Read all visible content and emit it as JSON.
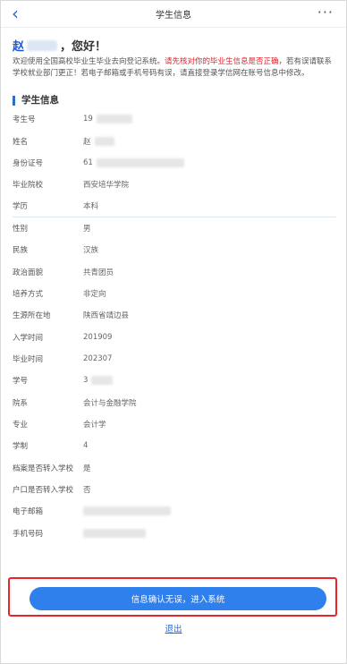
{
  "header": {
    "title": "学生信息",
    "back_icon": "chevron-left-icon",
    "more_icon": "more-dots-icon"
  },
  "greeting": {
    "surname": "赵",
    "suffix": "，您好！"
  },
  "intro": {
    "text_before": "欢迎使用全国高校毕业生毕业去向登记系统。",
    "text_red": "请先核对你的毕业生信息是否正确",
    "text_after": "，若有误请联系学校就业部门更正！若电子邮箱或手机号码有误，请直接登录学信网在账号信息中修改。"
  },
  "section": {
    "title": "学生信息"
  },
  "fields": [
    {
      "label": "考生号",
      "value": "19"
    },
    {
      "label": "姓名",
      "value": "赵"
    },
    {
      "label": "身份证号",
      "value": "61"
    },
    {
      "label": "毕业院校",
      "value": "西安培华学院"
    },
    {
      "label": "学历",
      "value": "本科"
    },
    {
      "label": "性别",
      "value": "男"
    },
    {
      "label": "民族",
      "value": "汉族"
    },
    {
      "label": "政治面貌",
      "value": "共青团员"
    },
    {
      "label": "培养方式",
      "value": "非定向"
    },
    {
      "label": "生源所在地",
      "value": "陕西省靖边县"
    },
    {
      "label": "入学时间",
      "value": "201909"
    },
    {
      "label": "毕业时间",
      "value": "202307"
    },
    {
      "label": "学号",
      "value": "3"
    },
    {
      "label": "院系",
      "value": "会计与金融学院"
    },
    {
      "label": "专业",
      "value": "会计学"
    },
    {
      "label": "学制",
      "value": "4"
    },
    {
      "label": "档案是否转入学校",
      "value": "是"
    },
    {
      "label": "户口是否转入学校",
      "value": "否"
    },
    {
      "label": "电子邮箱",
      "value": ""
    },
    {
      "label": "手机号码",
      "value": ""
    }
  ],
  "actions": {
    "confirm_label": "信息确认无误，进入系统",
    "logout_label": "退出"
  },
  "colors": {
    "accent": "#2f7fec",
    "highlight_red": "#e0242b",
    "frame_red": "#e8252d"
  }
}
